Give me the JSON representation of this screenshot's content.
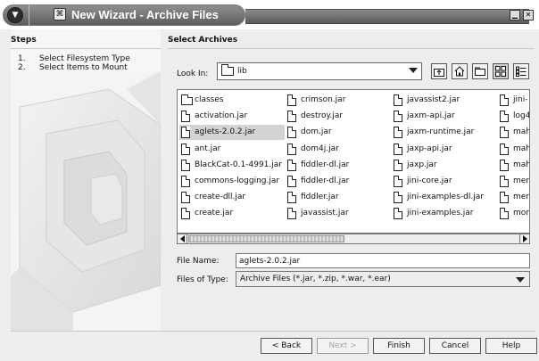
{
  "window": {
    "title": "New Wizard - Archive Files",
    "title_icon": "wizard-icon",
    "control_buttons": [
      "minimize-icon",
      "close-icon"
    ]
  },
  "steps": {
    "title": "Steps",
    "items": [
      {
        "num": "1.",
        "label": "Select Filesystem Type",
        "current": false
      },
      {
        "num": "2.",
        "label": "Select Items to Mount",
        "current": true
      }
    ]
  },
  "panel": {
    "title": "Select Archives",
    "look_in_label": "Look In:",
    "look_in_value": "lib",
    "toolbar_icons": [
      "up-folder-icon",
      "home-icon",
      "new-folder-icon",
      "list-view-icon",
      "details-view-icon"
    ],
    "files": [
      {
        "name": "classes",
        "type": "folder",
        "selected": false
      },
      {
        "name": "activation.jar",
        "type": "file",
        "selected": false
      },
      {
        "name": "aglets-2.0.2.jar",
        "type": "file",
        "selected": true
      },
      {
        "name": "ant.jar",
        "type": "file",
        "selected": false
      },
      {
        "name": "BlackCat-0.1-4991.jar",
        "type": "file",
        "selected": false
      },
      {
        "name": "commons-logging.jar",
        "type": "file",
        "selected": false
      },
      {
        "name": "create-dll.jar",
        "type": "file",
        "selected": false
      },
      {
        "name": "create.jar",
        "type": "file",
        "selected": false
      },
      {
        "name": "crimson.jar",
        "type": "file",
        "selected": false
      },
      {
        "name": "destroy.jar",
        "type": "file",
        "selected": false
      },
      {
        "name": "dom.jar",
        "type": "file",
        "selected": false
      },
      {
        "name": "dom4j.jar",
        "type": "file",
        "selected": false
      },
      {
        "name": "fiddler-dl.jar",
        "type": "file",
        "selected": false
      },
      {
        "name": "fiddler-dl.jar",
        "type": "file",
        "selected": false
      },
      {
        "name": "fiddler.jar",
        "type": "file",
        "selected": false
      },
      {
        "name": "javassist.jar",
        "type": "file",
        "selected": false
      },
      {
        "name": "javassist2.jar",
        "type": "file",
        "selected": false
      },
      {
        "name": "jaxm-api.jar",
        "type": "file",
        "selected": false
      },
      {
        "name": "jaxm-runtime.jar",
        "type": "file",
        "selected": false
      },
      {
        "name": "jaxp-api.jar",
        "type": "file",
        "selected": false
      },
      {
        "name": "jaxp.jar",
        "type": "file",
        "selected": false
      },
      {
        "name": "jini-core.jar",
        "type": "file",
        "selected": false
      },
      {
        "name": "jini-examples-dl.jar",
        "type": "file",
        "selected": false
      },
      {
        "name": "jini-examples.jar",
        "type": "file",
        "selected": false
      },
      {
        "name": "jini-",
        "type": "file",
        "selected": false
      },
      {
        "name": "log4",
        "type": "file",
        "selected": false
      },
      {
        "name": "mah",
        "type": "file",
        "selected": false
      },
      {
        "name": "mah",
        "type": "file",
        "selected": false
      },
      {
        "name": "mah",
        "type": "file",
        "selected": false
      },
      {
        "name": "mer",
        "type": "file",
        "selected": false
      },
      {
        "name": "mer",
        "type": "file",
        "selected": false
      },
      {
        "name": "mor",
        "type": "file",
        "selected": false
      }
    ],
    "file_name_label": "File Name:",
    "file_name_value": "aglets-2.0.2.jar",
    "file_type_label": "Files of Type:",
    "file_type_value": "Archive Files (*.jar, *.zip, *.war, *.ear)"
  },
  "buttons": {
    "back": "< Back",
    "next": "Next >",
    "finish": "Finish",
    "cancel": "Cancel",
    "help": "Help"
  }
}
